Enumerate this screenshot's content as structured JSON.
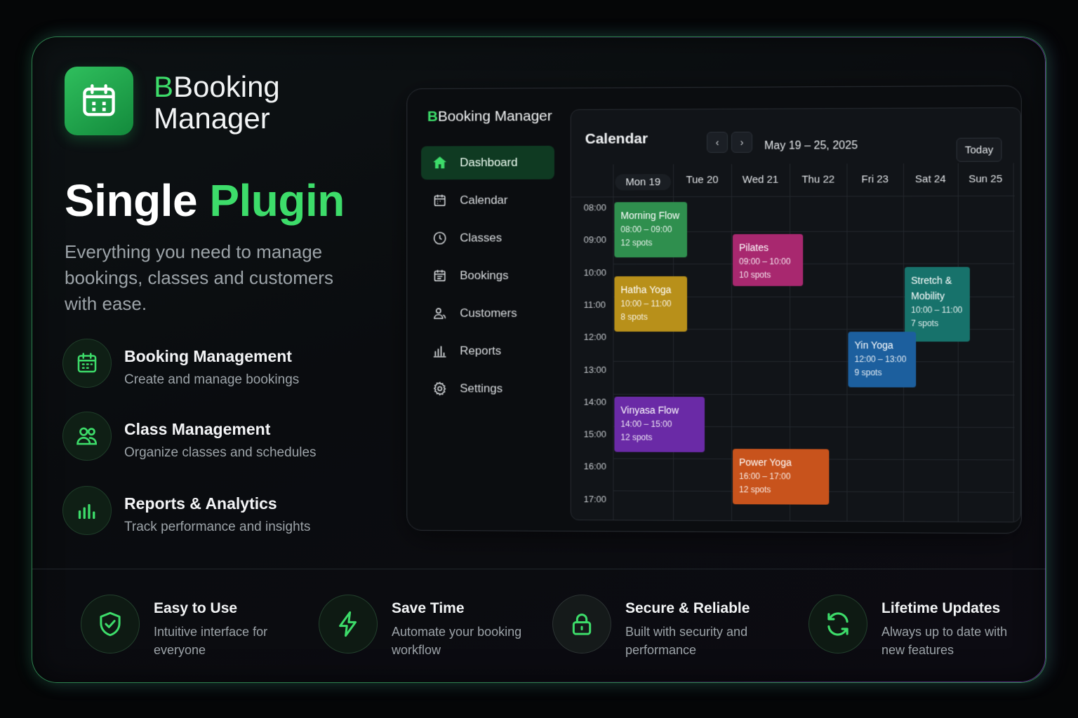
{
  "brand": {
    "initial": "B",
    "name_line1": "Booking",
    "name_line2": "Manager"
  },
  "hero": {
    "title_white": "Single",
    "title_green": "Plugin",
    "subtitle": "Everything you need to manage bookings, classes and customers with ease."
  },
  "features": [
    {
      "icon": "calendar-icon",
      "title": "Booking Management",
      "desc": "Create and manage bookings"
    },
    {
      "icon": "users-icon",
      "title": "Class Management",
      "desc": "Organize classes and schedules"
    },
    {
      "icon": "bar-chart-icon",
      "title": "Reports & Analytics",
      "desc": "Track performance and insights"
    }
  ],
  "app": {
    "brand_initial": "B",
    "brand_name": "Booking Manager",
    "nav": [
      {
        "icon": "home-icon",
        "label": "Dashboard",
        "active": true
      },
      {
        "icon": "calendar-icon",
        "label": "Calendar"
      },
      {
        "icon": "clock-icon",
        "label": "Classes"
      },
      {
        "icon": "calendar-list-icon",
        "label": "Bookings"
      },
      {
        "icon": "user-icon",
        "label": "Customers"
      },
      {
        "icon": "bar-chart-icon",
        "label": "Reports"
      },
      {
        "icon": "gear-icon",
        "label": "Settings"
      }
    ],
    "calendar": {
      "title": "Calendar",
      "prev": "‹",
      "next": "›",
      "range": "May 19 – 25, 2025",
      "today": "Today",
      "days": [
        "Mon 19",
        "Tue 20",
        "Wed 21",
        "Thu 22",
        "Fri 23",
        "Sat 24",
        "Sun 25"
      ],
      "active_day": 0,
      "times": [
        "08:00",
        "09:00",
        "10:00",
        "11:00",
        "12:00",
        "13:00",
        "14:00",
        "15:00",
        "16:00",
        "17:00"
      ],
      "events": [
        {
          "name": "Morning Flow",
          "time": "08:00 – 09:00",
          "spots": "12 spots",
          "day": 0,
          "start": 8,
          "end": 9.7,
          "color": "#2f8f4e"
        },
        {
          "name": "Hatha Yoga",
          "time": "10:00 – 11:00",
          "spots": "8 spots",
          "day": 0,
          "start": 10.3,
          "end": 12,
          "color": "#b8901a"
        },
        {
          "name": "Pilates",
          "time": "09:00 – 10:00",
          "spots": "10 spots",
          "day": 2,
          "start": 9,
          "end": 10.6,
          "color": "#a8286f"
        },
        {
          "name": "Stretch & Mobility",
          "time": "10:00 – 11:00",
          "spots": "7 spots",
          "day": 5,
          "start": 10,
          "end": 12.3,
          "color": "#17726b"
        },
        {
          "name": "Yin Yoga",
          "time": "12:00 – 13:00",
          "spots": "9 spots",
          "day": 4,
          "start": 12,
          "end": 13.7,
          "color": "#1c5f9e"
        },
        {
          "name": "Vinyasa Flow",
          "time": "14:00 – 15:00",
          "spots": "12 spots",
          "day": 0,
          "start": 14,
          "end": 15.7,
          "color": "#6a2aa6"
        },
        {
          "name": "Power Yoga",
          "time": "16:00 – 17:00",
          "spots": "12 spots",
          "day": 2,
          "start": 15.6,
          "end": 17.3,
          "color": "#c8531c"
        }
      ]
    }
  },
  "bottom_features": [
    {
      "icon": "shield-check-icon",
      "title": "Easy to Use",
      "desc": "Intuitive interface for everyone"
    },
    {
      "icon": "lightning-icon",
      "title": "Save Time",
      "desc": "Automate your booking workflow"
    },
    {
      "icon": "lock-icon",
      "title": "Secure & Reliable",
      "desc": "Built with security and performance"
    },
    {
      "icon": "refresh-icon",
      "title": "Lifetime Updates",
      "desc": "Always up to date with new features"
    }
  ],
  "colors": {
    "accent": "#3ddc6a",
    "background": "#050607",
    "nav_active": "#0f3a22"
  }
}
